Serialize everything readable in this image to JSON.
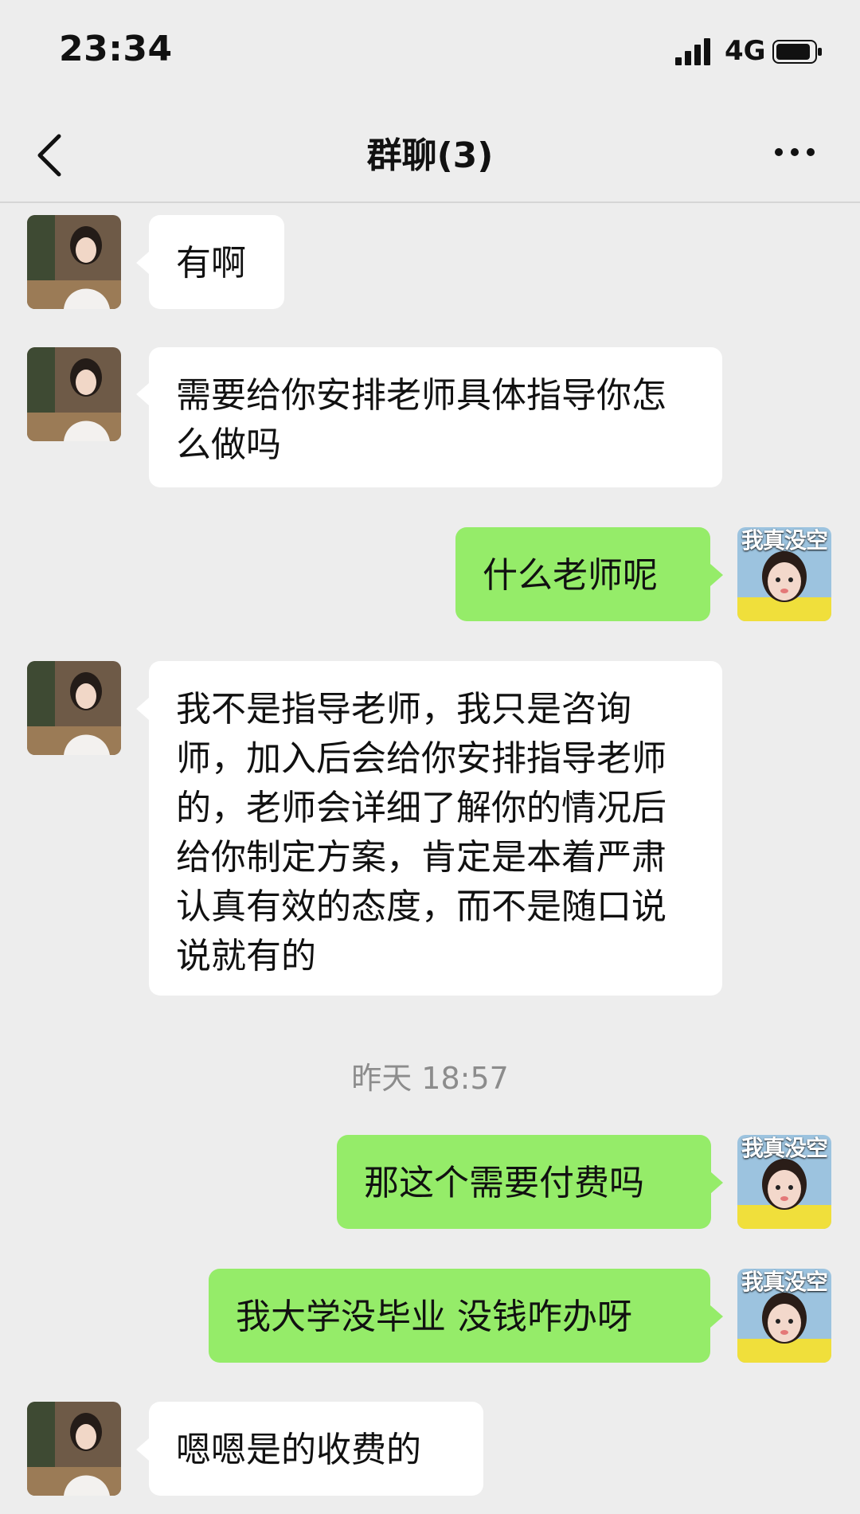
{
  "status_bar": {
    "time": "23:34",
    "network": "4G",
    "icons": [
      "signal-icon",
      "battery-icon"
    ]
  },
  "nav": {
    "title": "群聊(3)",
    "back_icon": "chevron-left-icon",
    "more_icon": "more-icon"
  },
  "messages": [
    {
      "side": "left",
      "text": "有啊"
    },
    {
      "side": "left",
      "text": "需要给你安排老师具体指导你怎么做吗"
    },
    {
      "side": "right",
      "text": "什么老师呢"
    },
    {
      "side": "left",
      "text": "我不是指导老师，我只是咨询师，加入后会给你安排指导老师的，老师会详细了解你的情况后给你制定方案，肯定是本着严肃认真有效的态度，而不是随口说说就有的"
    },
    {
      "side": "right",
      "text": "那这个需要付费吗"
    },
    {
      "side": "right",
      "text": "我大学没毕业 没钱咋办呀"
    },
    {
      "side": "left",
      "text": "嗯嗯是的收费的"
    }
  ],
  "timestamp": "昨天 18:57",
  "right_avatar_caption": "我真没空",
  "colors": {
    "background": "#ededed",
    "incoming_bubble": "#ffffff",
    "outgoing_bubble": "#95ec69"
  }
}
